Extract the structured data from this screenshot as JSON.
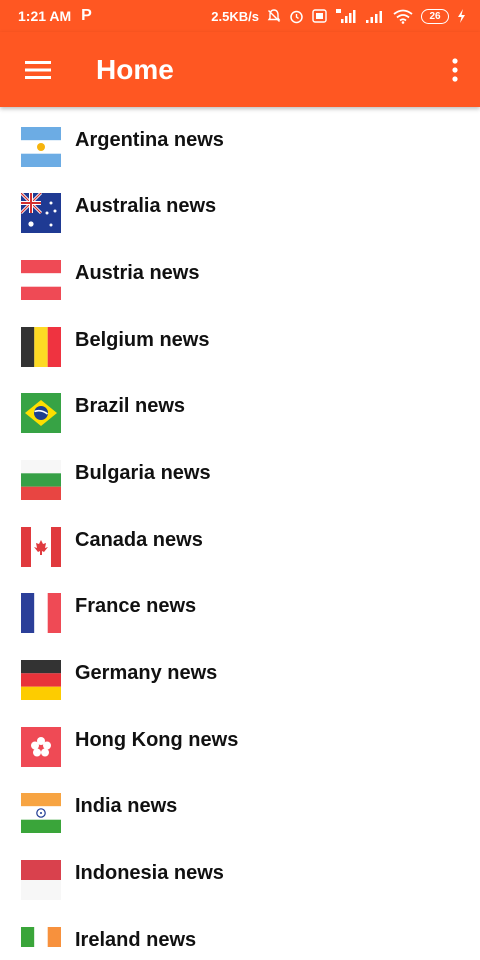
{
  "status": {
    "time": "1:21 AM",
    "p_icon": "P",
    "speed": "2.5KB/s",
    "battery": "26",
    "icons": [
      "notification-off-icon",
      "alarm-icon",
      "volte-icon",
      "signal-4g-icon",
      "signal-icon",
      "wifi-icon",
      "battery-icon",
      "charging-icon"
    ]
  },
  "appbar": {
    "title": "Home",
    "menu_icon": "hamburger-menu-icon",
    "more_icon": "more-vert-icon",
    "color": "#ff5722"
  },
  "countries": [
    {
      "id": "argentina",
      "label": "Argentina news",
      "flag": "argentina-flag-icon"
    },
    {
      "id": "australia",
      "label": "Australia news",
      "flag": "australia-flag-icon"
    },
    {
      "id": "austria",
      "label": "Austria news",
      "flag": "austria-flag-icon"
    },
    {
      "id": "belgium",
      "label": "Belgium news",
      "flag": "belgium-flag-icon"
    },
    {
      "id": "brazil",
      "label": "Brazil news",
      "flag": "brazil-flag-icon"
    },
    {
      "id": "bulgaria",
      "label": "Bulgaria news",
      "flag": "bulgaria-flag-icon"
    },
    {
      "id": "canada",
      "label": "Canada news",
      "flag": "canada-flag-icon"
    },
    {
      "id": "france",
      "label": "France news",
      "flag": "france-flag-icon"
    },
    {
      "id": "germany",
      "label": "Germany news",
      "flag": "germany-flag-icon"
    },
    {
      "id": "hongkong",
      "label": "Hong Kong news",
      "flag": "hong-kong-flag-icon"
    },
    {
      "id": "india",
      "label": "India news",
      "flag": "india-flag-icon"
    },
    {
      "id": "indonesia",
      "label": "Indonesia news",
      "flag": "indonesia-flag-icon"
    },
    {
      "id": "ireland",
      "label": "Ireland news",
      "flag": "ireland-flag-icon"
    }
  ]
}
